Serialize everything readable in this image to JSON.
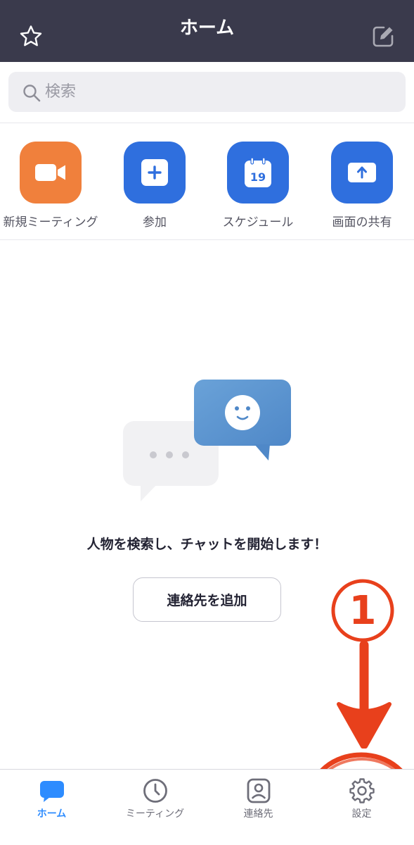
{
  "header": {
    "title": "ホーム",
    "left_icon": "star-icon",
    "right_icon": "edit-icon"
  },
  "search": {
    "placeholder": "検索"
  },
  "actions": [
    {
      "label": "新規ミーティング",
      "icon": "video-camera-icon",
      "color": "#f0803c"
    },
    {
      "label": "参加",
      "icon": "plus-icon",
      "color": "#2f6fde"
    },
    {
      "label": "スケジュール",
      "icon": "calendar-icon",
      "color": "#2f6fde",
      "calendar_day": "19"
    },
    {
      "label": "画面の共有",
      "icon": "share-screen-icon",
      "color": "#2f6fde"
    }
  ],
  "empty_state": {
    "message": "人物を検索し、チャットを開始します！",
    "button_label": "連絡先を追加"
  },
  "annotation": {
    "marker": "①",
    "color": "#e8401c"
  },
  "tabs": [
    {
      "label": "ホーム",
      "icon": "chat-bubble-icon",
      "active": true
    },
    {
      "label": "ミーティング",
      "icon": "clock-icon",
      "active": false
    },
    {
      "label": "連絡先",
      "icon": "contact-icon",
      "active": false
    },
    {
      "label": "設定",
      "icon": "gear-icon",
      "active": false
    }
  ],
  "colors": {
    "header_bg": "#3a3a4c",
    "accent": "#2d8cff",
    "orange": "#f0803c",
    "blue": "#2f6fde"
  }
}
